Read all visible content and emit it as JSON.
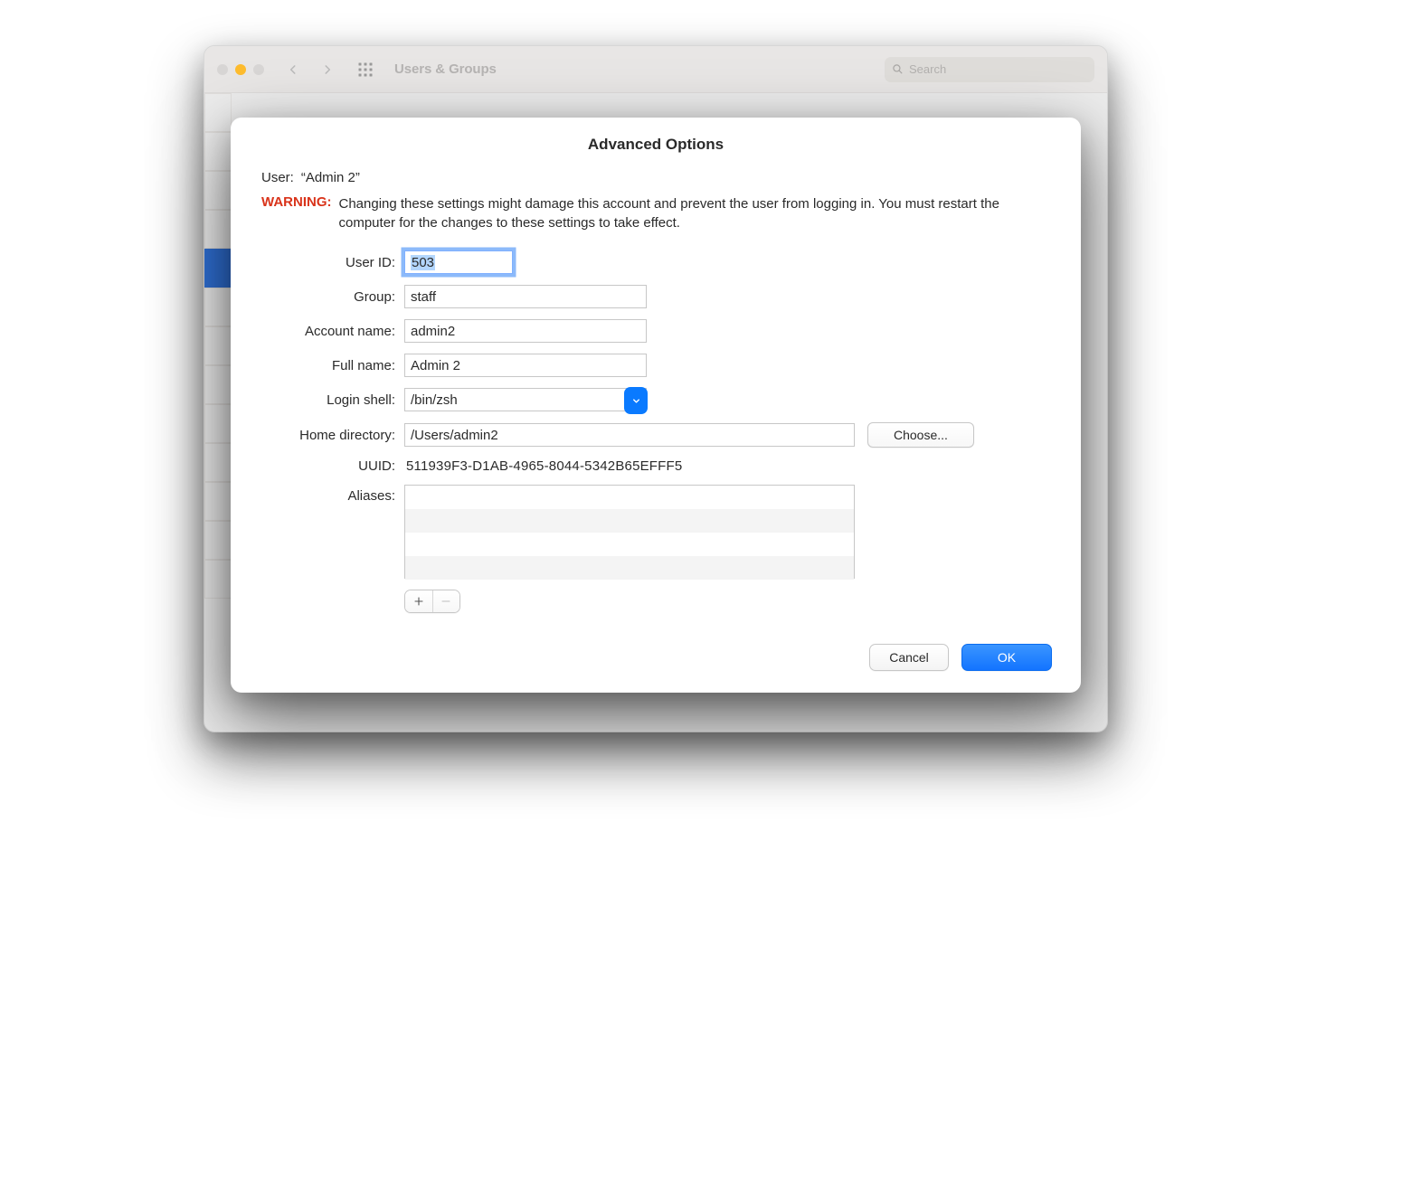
{
  "background": {
    "window_title": "Users & Groups",
    "search_placeholder": "Search"
  },
  "sheet": {
    "title": "Advanced Options",
    "user_label": "User:",
    "user_value": "“Admin 2”",
    "warning_label": "WARNING:",
    "warning_text": "Changing these settings might damage this account and prevent the user from logging in. You must restart the computer for the changes to these settings to take effect.",
    "fields": {
      "user_id": {
        "label": "User ID:",
        "value": "503"
      },
      "group": {
        "label": "Group:",
        "value": "staff"
      },
      "account_name": {
        "label": "Account name:",
        "value": "admin2"
      },
      "full_name": {
        "label": "Full name:",
        "value": "Admin 2"
      },
      "login_shell": {
        "label": "Login shell:",
        "value": "/bin/zsh"
      },
      "home_directory": {
        "label": "Home directory:",
        "value": "/Users/admin2",
        "choose_label": "Choose..."
      },
      "uuid": {
        "label": "UUID:",
        "value": "511939F3-D1AB-4965-8044-5342B65EFFF5"
      },
      "aliases": {
        "label": "Aliases:"
      }
    },
    "footer": {
      "cancel": "Cancel",
      "ok": "OK"
    }
  }
}
